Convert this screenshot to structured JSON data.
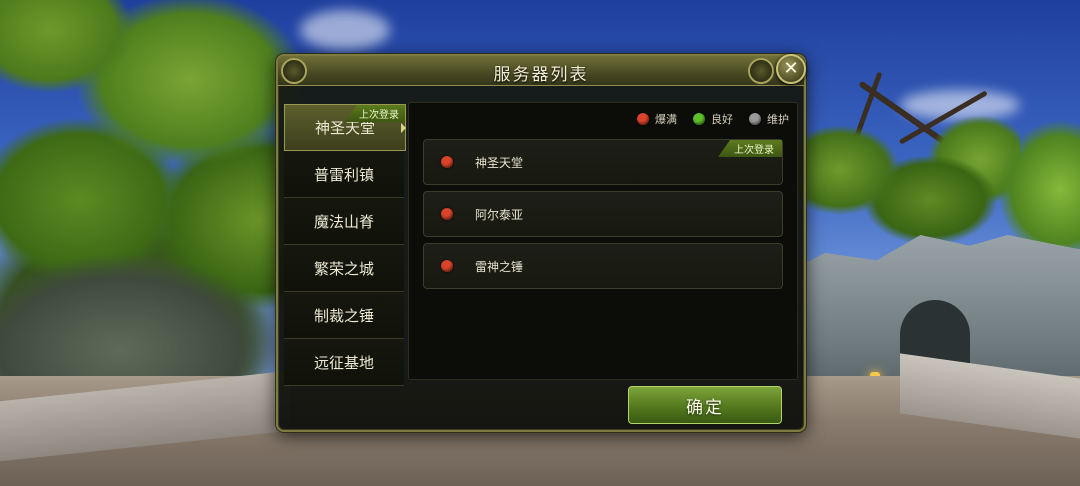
{
  "dialog": {
    "title": "服务器列表",
    "close_symbol": "✕",
    "confirm_label": "确定"
  },
  "legend": [
    {
      "label": "爆满",
      "color": "#d9442a"
    },
    {
      "label": "良好",
      "color": "#5ec02a"
    },
    {
      "label": "维护",
      "color": "#9a9a9a"
    }
  ],
  "groups": [
    {
      "label": "神圣天堂",
      "badge": "上次登录",
      "active": true
    },
    {
      "label": "普雷利镇"
    },
    {
      "label": "魔法山脊"
    },
    {
      "label": "繁荣之城"
    },
    {
      "label": "制裁之锤"
    },
    {
      "label": "远征基地"
    }
  ],
  "servers": [
    {
      "name": "神圣天堂",
      "status": "爆满",
      "badge": "上次登录"
    },
    {
      "name": "阿尔泰亚",
      "status": "爆满"
    },
    {
      "name": "雷神之锤",
      "status": "爆满"
    }
  ],
  "colors": {
    "full": "#d9442a",
    "good": "#5ec02a",
    "maintenance": "#9a9a9a",
    "accent_green": "#52791e",
    "frame_gold": "#7d7a42"
  }
}
